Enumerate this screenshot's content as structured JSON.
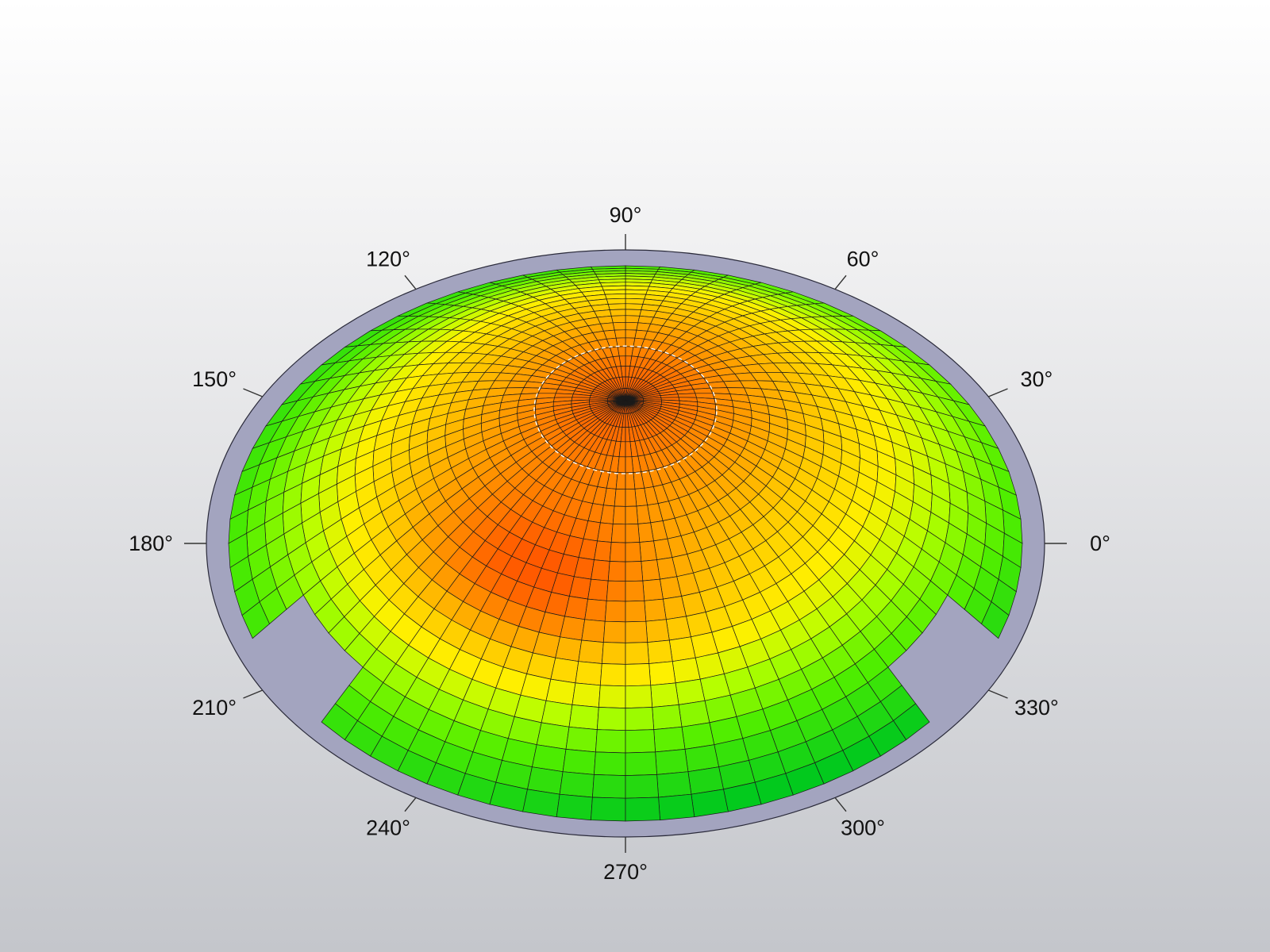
{
  "chart_data": {
    "type": "heatmap",
    "subtype": "polar-dome-3d",
    "azimuth_labels": [
      "0°",
      "30°",
      "60°",
      "90°",
      "120°",
      "150°",
      "180°",
      "210°",
      "240°",
      "270°",
      "300°",
      "330°"
    ],
    "azimuth_values": [
      0,
      30,
      60,
      90,
      120,
      150,
      180,
      210,
      240,
      270,
      300,
      330
    ],
    "rings": 22,
    "segments": 72,
    "peak_center": {
      "azimuth": 90,
      "level": 1.0
    },
    "secondary_peak": {
      "azimuth": 245,
      "radial_fraction": 0.55,
      "level": 0.95
    },
    "edge_level": 0.15,
    "missing_arcs_deg": [
      [
        198,
        218
      ],
      [
        322,
        340
      ]
    ],
    "colors": {
      "low": "#00cc22",
      "mid_low": "#88ff00",
      "mid": "#ffee00",
      "mid_high": "#ffaa00",
      "high": "#ff5500",
      "base_ring": "#a3a4bf",
      "grid": "#1a1a1a",
      "highlight_ring": "#ffffff"
    },
    "grid": true,
    "legend": "none"
  }
}
